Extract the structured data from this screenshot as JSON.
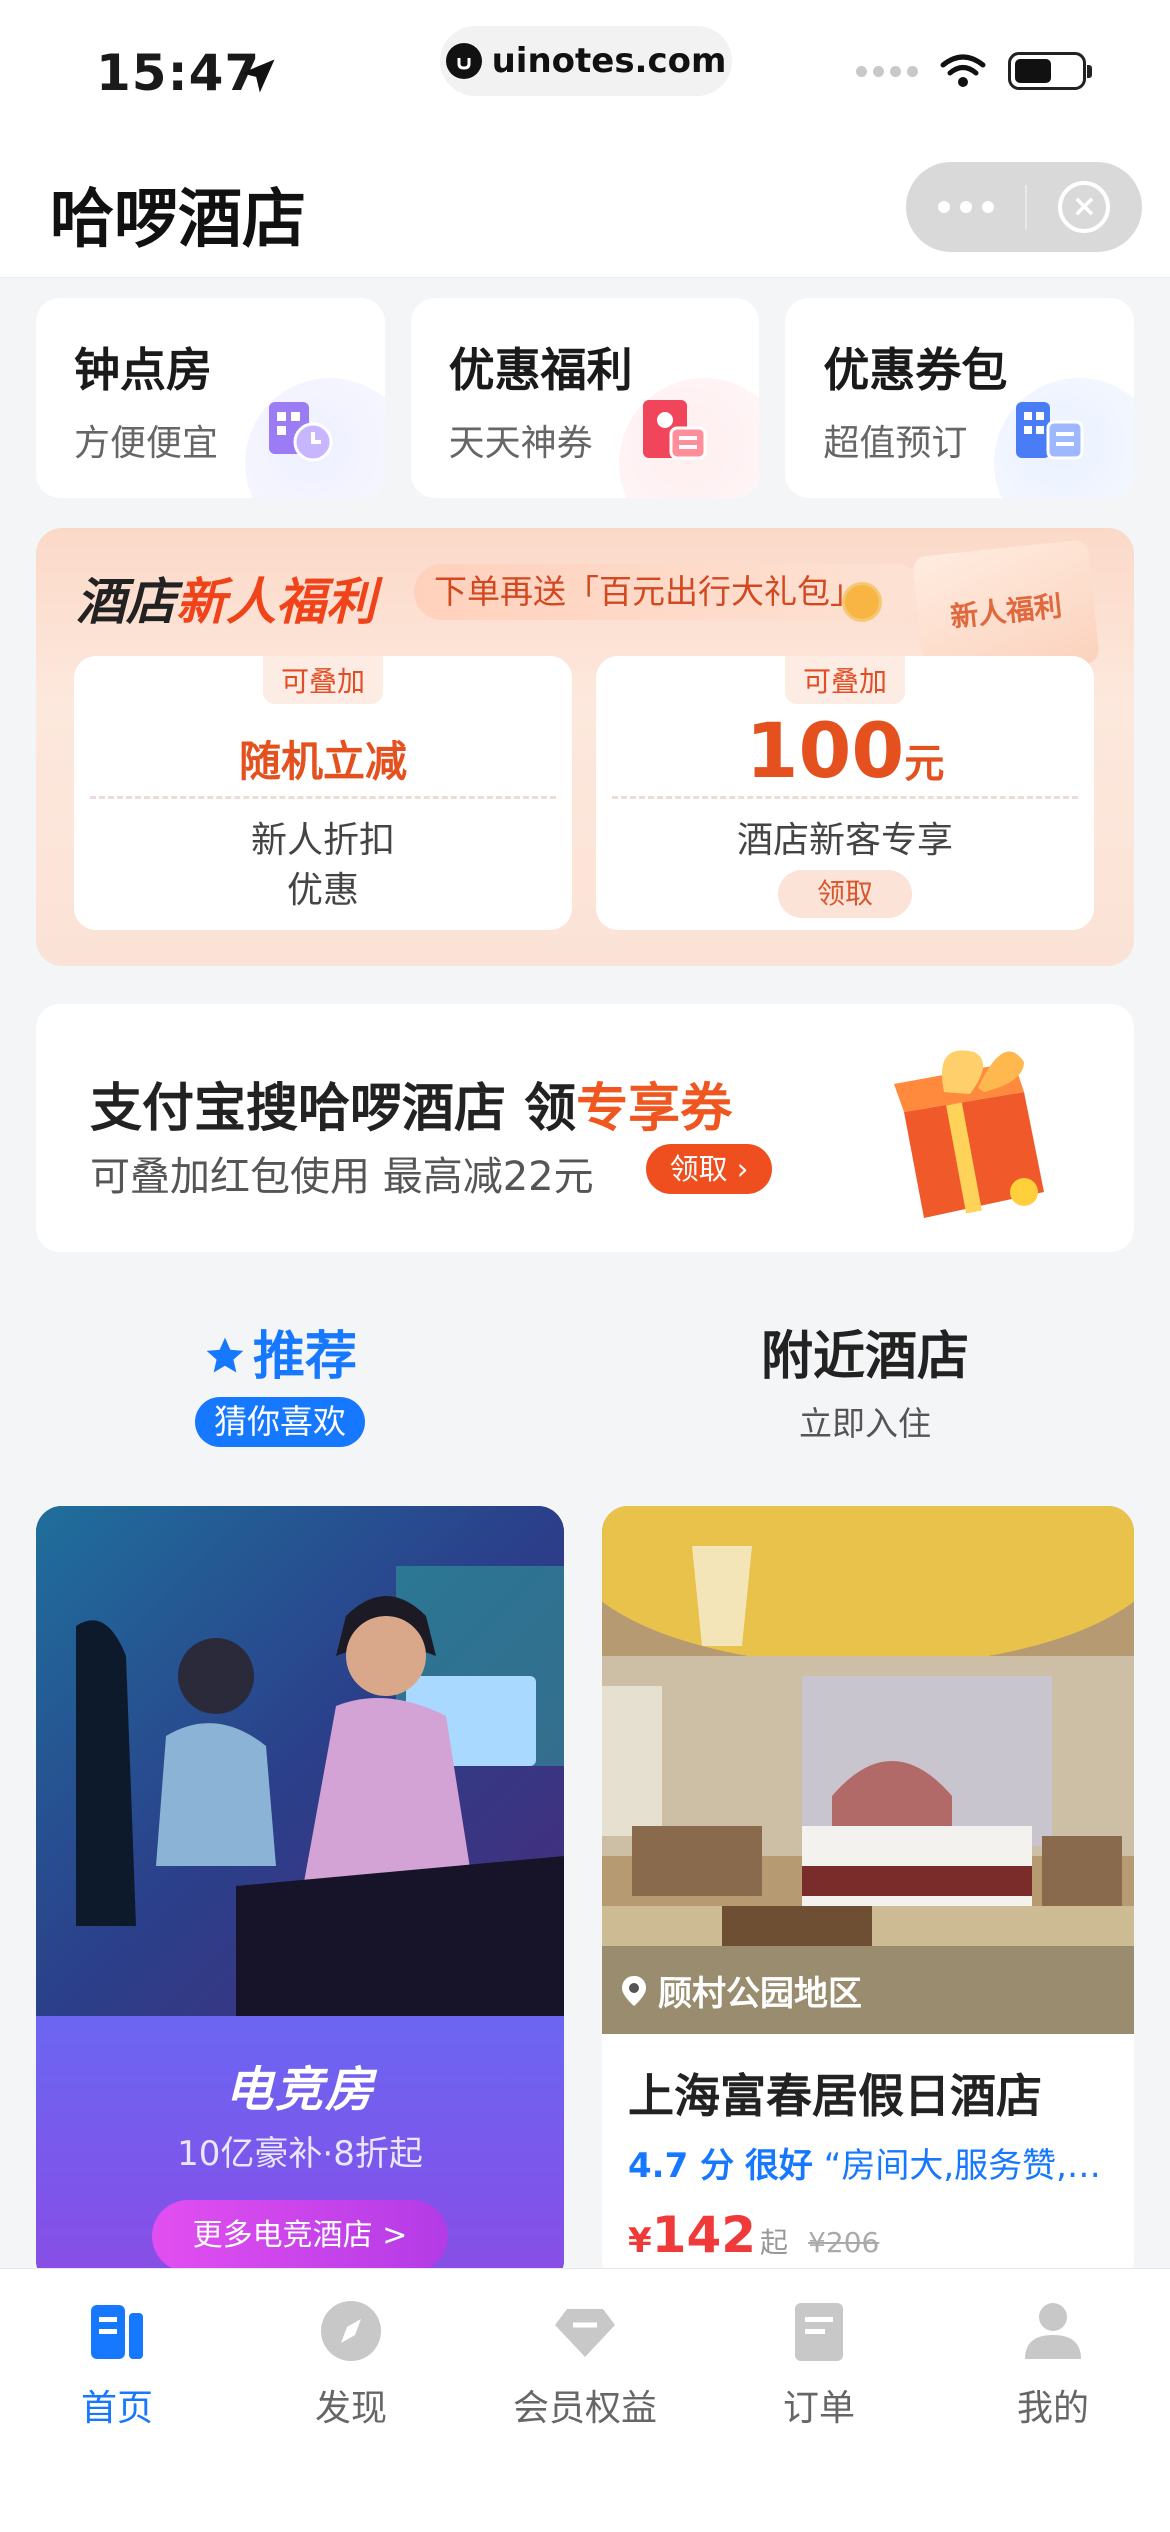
{
  "status_bar": {
    "time": "15:47",
    "url": "uinotes.com"
  },
  "nav": {
    "title": "哈啰酒店"
  },
  "quick_entries": [
    {
      "title": "钟点房",
      "subtitle": "方便便宜",
      "icon": "hourly-room-icon"
    },
    {
      "title": "优惠福利",
      "subtitle": "天天神券",
      "icon": "welfare-icon"
    },
    {
      "title": "优惠券包",
      "subtitle": "超值预订",
      "icon": "coupon-pack-icon"
    }
  ],
  "welfare": {
    "title_prefix": "酒店",
    "title_highlight": "新人福利",
    "note": "下单再送「百元出行大礼包」",
    "badge": "新人福利",
    "coupon1": {
      "tag": "可叠加",
      "main": "随机立减",
      "sub1": "新人折扣",
      "sub2": "优惠"
    },
    "coupon2": {
      "tag": "可叠加",
      "amount": "100",
      "unit": "元",
      "sub": "酒店新客专享",
      "claim": "领取"
    }
  },
  "promo": {
    "line1_prefix": "支付宝搜哈啰酒店 领",
    "line1_highlight": "专享券",
    "line2": "可叠加红包使用 最高减22元",
    "button": "领取"
  },
  "tabs": [
    {
      "label": "推荐",
      "sub": "猜你喜欢",
      "active": true
    },
    {
      "label": "附近酒店",
      "sub": "立即入住",
      "active": false
    }
  ],
  "cards": {
    "game": {
      "title": "电竞房",
      "subtitle": "10亿豪补·8折起",
      "button": "更多电竞酒店 >"
    },
    "hotel": {
      "location": "顾村公园地区",
      "name": "上海富春居假日酒店",
      "score": "4.7 分",
      "level": "很好",
      "review": "“房间大,服务赞,…",
      "currency": "¥",
      "price": "142",
      "price_suffix": "起",
      "original_price": "¥206"
    }
  },
  "tabbar": [
    {
      "label": "首页",
      "icon": "home-icon",
      "active": true
    },
    {
      "label": "发现",
      "icon": "compass-icon",
      "active": false
    },
    {
      "label": "会员权益",
      "icon": "diamond-icon",
      "active": false
    },
    {
      "label": "订单",
      "icon": "order-icon",
      "active": false
    },
    {
      "label": "我的",
      "icon": "profile-icon",
      "active": false
    }
  ],
  "colors": {
    "accent_blue": "#1677ff",
    "accent_orange": "#f0561f",
    "price_red": "#f03a3a"
  }
}
